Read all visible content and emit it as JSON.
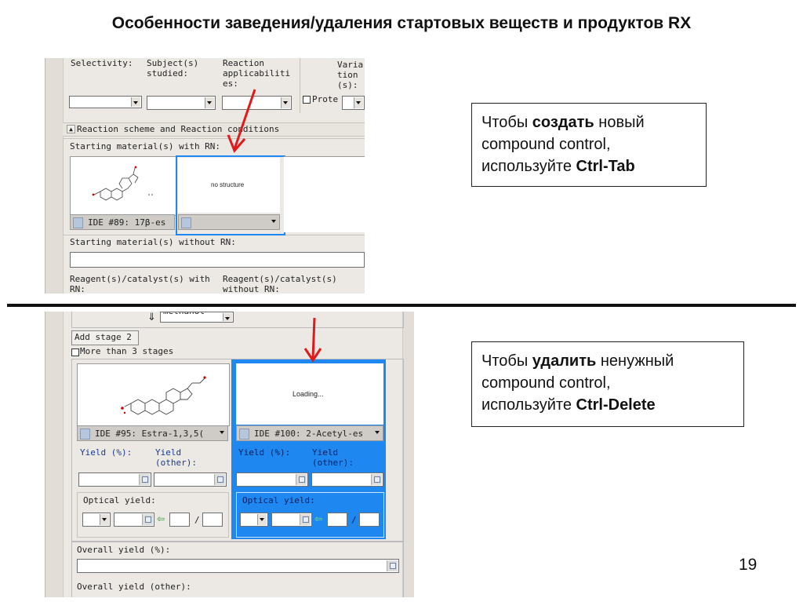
{
  "title": "Особенности заведения/удаления стартовых веществ и продуктов RX",
  "page_number": "19",
  "top_panel": {
    "selectivity_label": "Selectivity:",
    "subjects_label_1": "Subject(s)",
    "subjects_label_2": "studied:",
    "reaction_app_1": "Reaction",
    "reaction_app_2": "applicabiliti",
    "reaction_app_3": "es:",
    "variation_1": "Varia",
    "variation_2": "tion",
    "variation_3": "(s):",
    "prot_label": "Prote",
    "section_header": "Reaction scheme and Reaction conditions",
    "starting_rn": "Starting material(s) with RN:",
    "compound1_label": "IDE #89: 17β-es",
    "no_structure": "no structure",
    "starting_without_rn": "Starting material(s) without RN:",
    "reagent_with_rn_1": "Reagent(s)/catalyst(s) with",
    "reagent_with_rn_2": "RN:",
    "reagent_without_rn_1": "Reagent(s)/catalyst(s)",
    "reagent_without_rn_2": "without RN:"
  },
  "bottom_panel": {
    "methanol_value": "methanol",
    "add_stage_label": "Add stage 2",
    "more_stages_label": "More than 3 stages",
    "compound1_label": "IDE #95: Estra-1,3,5(",
    "compound2_label": "IDE #100: 2-Acetyl-es",
    "loading_text": "Loading...",
    "yield_pct_label": "Yield (%):",
    "yield_other_1": "Yield",
    "yield_other_2": "(other):",
    "optical_yield_label": "Optical yield:",
    "slash": "/",
    "overall_yield_pct": "Overall yield (%):",
    "overall_yield_other": "Overall yield (other):"
  },
  "notes": {
    "note1": {
      "pre": "Чтобы ",
      "bold": "создать",
      "post": " новый",
      "line2": "compound control,",
      "line3_pre": "используйте ",
      "line3_bold": "Ctrl-Tab"
    },
    "note2": {
      "pre": "Чтобы ",
      "bold": "удалить",
      "post": " ненужный",
      "line2": "compound control,",
      "line3_pre": "используйте ",
      "line3_bold": "Ctrl-Delete"
    }
  },
  "colors": {
    "selection_blue": "#1e87f0",
    "arrow_red": "#e01a1a",
    "panel_bg": "#ece9e4"
  }
}
